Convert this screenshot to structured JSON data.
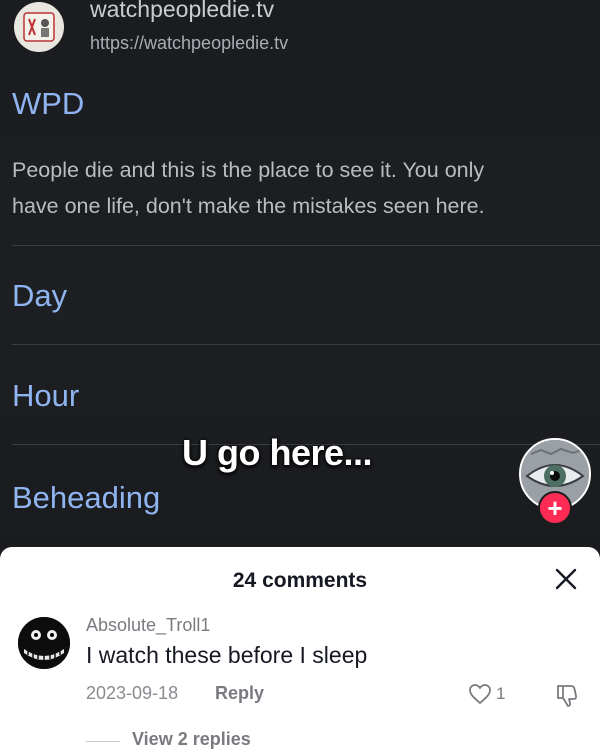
{
  "video": {
    "site_name": "watchpeopledie.tv",
    "site_url": "https://watchpeopledie.tv",
    "title": "WPD",
    "description_lines": [
      "People die and this is the place to see it. You only",
      "have one life, don't make the mistakes seen here."
    ],
    "filters": [
      "Day",
      "Hour",
      "Beheading"
    ],
    "overlay_text": "U go here...",
    "follow_symbol": "+"
  },
  "comments": {
    "header": "24 comments",
    "items": [
      {
        "username": "Absolute_Troll1",
        "text": "I watch these before I sleep",
        "date": "2023-09-18",
        "reply_label": "Reply",
        "likes": "1",
        "view_replies": "View 2 replies"
      }
    ]
  },
  "colors": {
    "video_bg": "#1b1d20",
    "link_blue": "#8fb4f0",
    "follow_red": "#fe2c55",
    "sheet_bg": "#ffffff"
  },
  "icons": [
    "site-logo-icon",
    "eye-avatar-icon",
    "plus-icon",
    "close-icon",
    "heart-icon",
    "dislike-icon"
  ]
}
